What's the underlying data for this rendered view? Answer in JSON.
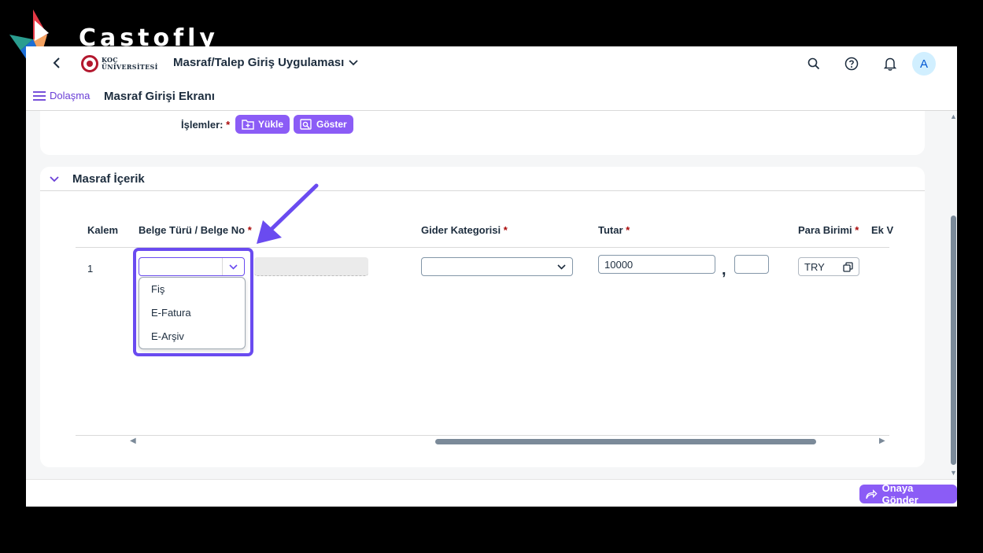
{
  "watermark": {
    "brand": "Castofly"
  },
  "shell": {
    "logo_line1": "KOÇ",
    "logo_line2": "ÜNİVERSİTESİ",
    "app_title": "Masraf/Talep Giriş Uygulaması",
    "avatar": "A"
  },
  "subheader": {
    "nav_label": "Dolaşma",
    "page_title": "Masraf Girişi Ekranı"
  },
  "operations": {
    "label": "İşlemler:",
    "required": "*",
    "upload_label": "Yükle",
    "show_label": "Göster"
  },
  "section": {
    "title": "Masraf İçerik",
    "columns": [
      {
        "label": "Kalem",
        "required": ""
      },
      {
        "label": "Belge Türü / Belge No",
        "required": "*"
      },
      {
        "label": "Gider Kategorisi",
        "required": "*"
      },
      {
        "label": "Tutar",
        "required": "*"
      },
      {
        "label": "Para Birimi",
        "required": "*"
      },
      {
        "label": "Ek V",
        "required": ""
      }
    ],
    "row": {
      "item_no": "1",
      "document_type": "",
      "expense_category": "",
      "amount": "10000",
      "decimal_separator": ",",
      "amount_decimal": "",
      "currency": "TRY"
    },
    "document_type_options": [
      "Fiş",
      "E-Fatura",
      "E-Arşiv"
    ]
  },
  "footer": {
    "send_label": "Onaya Gönder"
  },
  "colors": {
    "accent": "#8b5cf6",
    "highlight": "#6a4bf0",
    "brand_red": "#b3182e",
    "text": "#1d2d3e"
  }
}
